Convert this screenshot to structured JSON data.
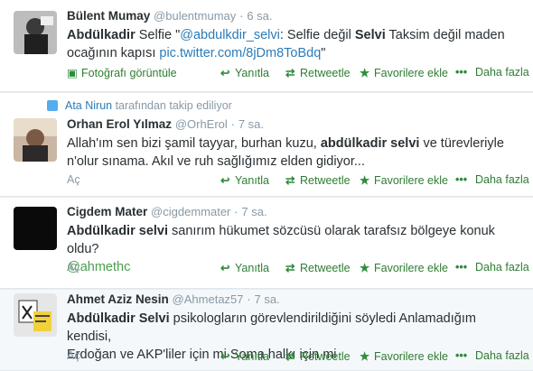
{
  "actions": {
    "reply": "Yanıtla",
    "retweet": "Retweetle",
    "favorite": "Favorilere ekle",
    "more": "Daha fazla",
    "expand": "Aç",
    "view_photo": "Fotoğrafı görüntüle"
  },
  "tweets": [
    {
      "fullname": "Bülent Mumay",
      "username": "@bulentmumay",
      "time": "6 sa.",
      "text_parts": {
        "a": "Abdülkadir",
        "b": " Selfie \"",
        "c": "@abdulkdir_selvi",
        "d": ": Selfie değil ",
        "e": "Selvi",
        "f": " Taksim  değil maden",
        "g": "ocağının kapısı ",
        "h": "pic.twitter.com/8jDm8ToBdq",
        "i": "\""
      }
    },
    {
      "context_name": "Ata Nirun",
      "context_text": " tarafından takip ediliyor",
      "fullname": "Orhan Erol Yılmaz",
      "username": "@OrhErol",
      "time": "7 sa.",
      "text_parts": {
        "a": "Allah'ım sen bizi şamil tayyar, burhan kuzu, ",
        "b": "abdülkadir selvi",
        "c": " ve türevleriyle",
        "d": "n'olur sınama. Akıl ve ruh sağlığımız elden gidiyor..."
      }
    },
    {
      "fullname": "Cigdem Mater",
      "username": "@cigdemmater",
      "time": "7 sa.",
      "text_parts": {
        "a": "Abdülkadir selvi",
        "b": " sanırım hükumet sözcüsü olarak tarafsız bölgeye konuk oldu?",
        "c": "@ahmethc"
      }
    },
    {
      "fullname": "Ahmet Aziz Nesin",
      "username": "@Ahmetaz57",
      "time": "7 sa.",
      "text_parts": {
        "a": "Abdülkadir Selvi",
        "b": " psikologların görevlendirildiğini söyledi Anlamadığım kendisi,",
        "c": "Erdoğan ve AKP'liler için mi Soma halkı için mi"
      }
    }
  ],
  "colors": {
    "link": "#2b7bb9",
    "action_green": "#2e7d32",
    "muted": "#8899a6"
  }
}
